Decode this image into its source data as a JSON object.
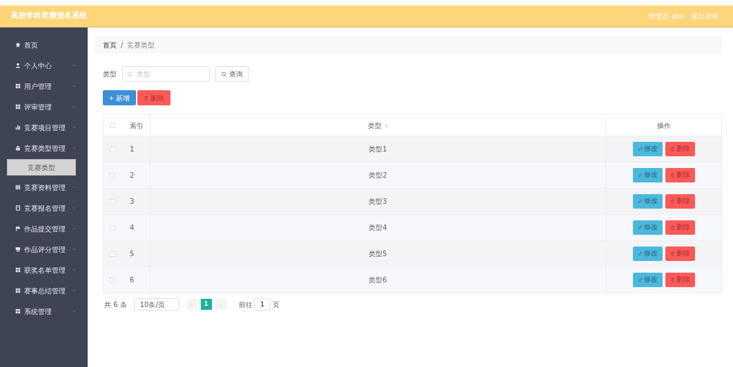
{
  "header": {
    "title": "高校学科竞赛报名系统",
    "user": "管理员 abo",
    "logout": "退出登录"
  },
  "sidebar": {
    "items": [
      {
        "label": "首页",
        "expandable": false
      },
      {
        "label": "个人中心",
        "expandable": true
      },
      {
        "label": "用户管理",
        "expandable": true
      },
      {
        "label": "评审管理",
        "expandable": true
      },
      {
        "label": "竞赛项目管理",
        "expandable": true
      },
      {
        "label": "竞赛类型管理",
        "expandable": true,
        "children": [
          {
            "label": "竞赛类型",
            "selected": true
          }
        ]
      },
      {
        "label": "竞赛资料管理",
        "expandable": true
      },
      {
        "label": "竞赛报名管理",
        "expandable": true
      },
      {
        "label": "作品提交管理",
        "expandable": true
      },
      {
        "label": "作品评分管理",
        "expandable": true
      },
      {
        "label": "获奖名单管理",
        "expandable": true
      },
      {
        "label": "赛事总结管理",
        "expandable": true
      },
      {
        "label": "系统管理",
        "expandable": true
      }
    ]
  },
  "breadcrumb": [
    "首页",
    "竞赛类型"
  ],
  "breadcrumb_separator": "/",
  "search": {
    "label": "类型",
    "placeholder": "类型",
    "button": "查询"
  },
  "actions": [
    {
      "label": "新增",
      "kind": "add"
    },
    {
      "label": "删除",
      "kind": "delete"
    }
  ],
  "table": {
    "select_all_checked": false,
    "columns": [
      {
        "label": "索引",
        "sortable": false
      },
      {
        "label": "类型",
        "sortable": true
      },
      {
        "label": "操作",
        "sortable": false
      }
    ],
    "rows": [
      {
        "index": "1",
        "type": "类型1",
        "checked": false,
        "buttons": [
          "修改",
          "删除"
        ]
      },
      {
        "index": "2",
        "type": "类型2",
        "checked": false,
        "buttons": [
          "修改",
          "删除"
        ]
      },
      {
        "index": "3",
        "type": "类型3",
        "checked": false,
        "buttons": [
          "修改",
          "删除"
        ]
      },
      {
        "index": "4",
        "type": "类型4",
        "checked": false,
        "buttons": [
          "修改",
          "删除"
        ]
      },
      {
        "index": "5",
        "type": "类型5",
        "checked": false,
        "buttons": [
          "修改",
          "删除"
        ]
      },
      {
        "index": "6",
        "type": "类型6",
        "checked": false,
        "buttons": [
          "修改",
          "删除"
        ]
      }
    ]
  },
  "pagination": {
    "total": "共 6 条",
    "page_size": "10条/页",
    "pages": [
      {
        "label": "1",
        "selected": true
      }
    ],
    "goto_label": "前往",
    "goto_value": "1",
    "goto_suffix": "页"
  }
}
